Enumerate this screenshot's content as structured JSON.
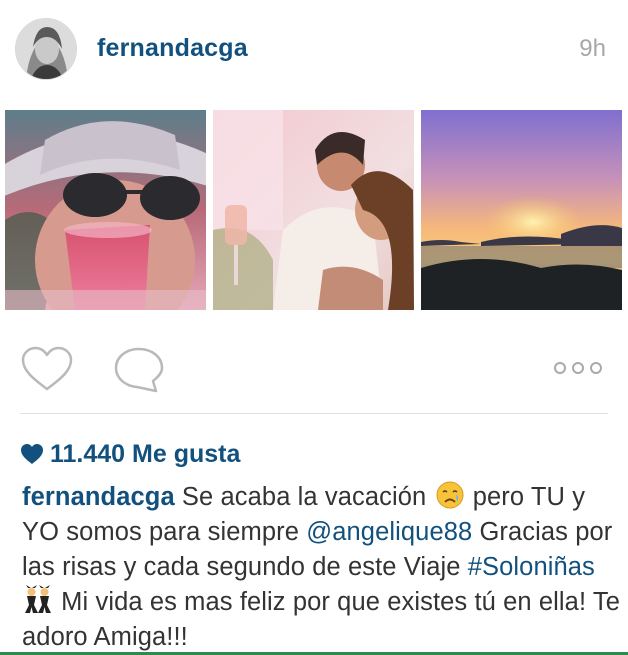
{
  "header": {
    "username": "fernandacga",
    "timestamp": "9h",
    "avatar_icon": "profile-photo"
  },
  "photos": [
    {
      "description_icon": "photo-selfie-sunglasses-drink"
    },
    {
      "description_icon": "photo-two-friends-toast"
    },
    {
      "description_icon": "photo-sunset-islands"
    }
  ],
  "actions": {
    "like_icon": "heart-outline-icon",
    "comment_icon": "speech-bubble-icon",
    "more_icon": "three-dots-icon"
  },
  "likes": {
    "count_label": "11.440 Me gusta"
  },
  "caption": {
    "username": "fernandacga",
    "text_1": " Se acaba la vacación ",
    "emoji_1": "crying-face-emoji",
    "text_2": " pero TU y YO somos para siempre ",
    "mention": "@angelique88",
    "text_3": " Gracias por las risas y cada segundo de este Viaje ",
    "hashtag": "#Soloniñas",
    "emoji_2": "dancers-emoji",
    "text_4": " Mi vida es mas feliz por que existes tú en ella! Te adoro Amiga!!!"
  },
  "colors": {
    "link_blue": "#12507e",
    "muted_gray": "#a7a7a7",
    "text": "#333333",
    "divider": "#e2e2e2"
  }
}
